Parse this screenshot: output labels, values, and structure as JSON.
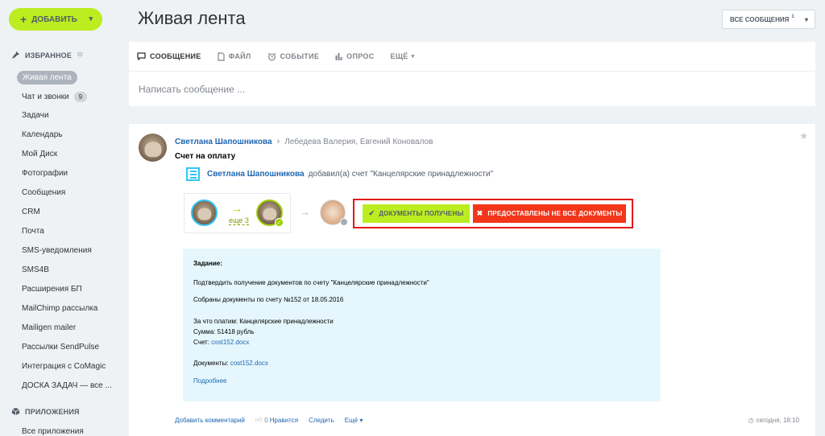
{
  "sidebar": {
    "add_button": "ДОБАВИТЬ",
    "favorites_header": "ИЗБРАННОЕ",
    "items": [
      {
        "label": "Живая лента",
        "active": true
      },
      {
        "label": "Чат и звонки",
        "counter": "9"
      },
      {
        "label": "Задачи"
      },
      {
        "label": "Календарь"
      },
      {
        "label": "Мой Диск"
      },
      {
        "label": "Фотографии"
      },
      {
        "label": "Сообщения"
      },
      {
        "label": "CRM"
      },
      {
        "label": "Почта"
      },
      {
        "label": "SMS-уведомления"
      },
      {
        "label": "SMS4B"
      },
      {
        "label": "Расширения БП"
      },
      {
        "label": "MailChimp рассылка"
      },
      {
        "label": "Mailigen mailer"
      },
      {
        "label": "Рассылки SendPulse"
      },
      {
        "label": "Интеграция с CoMagic"
      },
      {
        "label": "ДОСКА ЗАДАЧ — все ..."
      }
    ],
    "apps_header": "ПРИЛОЖЕНИЯ",
    "apps_item": "Все приложения"
  },
  "header": {
    "title": "Живая лента",
    "filter_label": "ВСЕ СООБЩЕНИЯ",
    "filter_count": "1"
  },
  "composer": {
    "tabs": [
      "СООБЩЕНИЕ",
      "ФАЙЛ",
      "СОБЫТИЕ",
      "ОПРОС",
      "ЕЩЁ"
    ],
    "placeholder": "Написать сообщение ..."
  },
  "post": {
    "author": "Светлана Шапошникова",
    "recipients": "Лебедева Валерия, Евгений Коновалов",
    "title": "Счет на оплату",
    "sub_author": "Светлана Шапошникова",
    "sub_action": "добавил(а) счет \"Канцелярские принадлежности\"",
    "workflow_more": "еще 3",
    "btn_ok": "ДОКУМЕНТЫ ПОЛУЧЕНЫ",
    "btn_no": "ПРЕДОСТАВЛЕНЫ НЕ ВСЕ ДОКУМЕНТЫ",
    "task": {
      "label": "Задание:",
      "line1": "Подтвердить получение документов по счету \"Канцелярские принадлежности\"",
      "line2": "Собраны документы по счету №152 от 18.05.2016",
      "pay_for": "За что платим: Канцелярские принадлежности",
      "sum": "Сумма: 51418 рубль",
      "invoice_label": "Счет:",
      "invoice_link": "cost152.docx",
      "docs_label": "Документы:",
      "docs_link": "cost152.docx",
      "more_link": "Подробнее"
    },
    "footer": {
      "add_comment": "Добавить комментарий",
      "likes": "0",
      "like_label": "Нравится",
      "follow": "Следить",
      "more": "Ещё",
      "time": "сегодня, 18:10"
    }
  },
  "colors": {
    "accent_green": "#bbed21",
    "accent_red": "#f1361a",
    "link_blue": "#2067b0",
    "frame_red": "#e01919"
  }
}
